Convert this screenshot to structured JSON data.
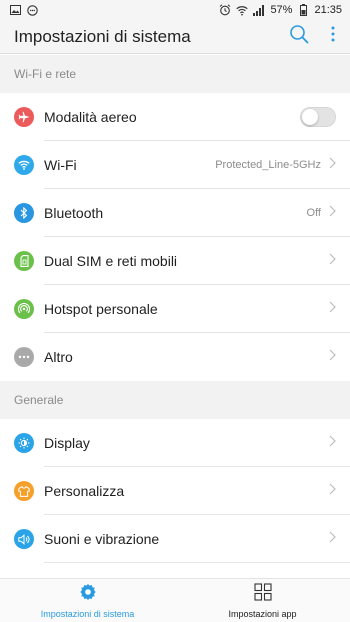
{
  "colors": {
    "accent": "#2a9be0",
    "airplane": "#ec5b5b",
    "wifi": "#2fa9e9",
    "bluetooth": "#2a95e0",
    "dual_sim": "#6bc04b",
    "hotspot": "#6bc04b",
    "altro": "#a9a9a9",
    "display": "#2aa4e6",
    "personalizza": "#f4a02a",
    "suoni": "#2aa4e6"
  },
  "status_bar": {
    "battery": "57%",
    "time": "21:35",
    "icons": [
      "image-icon",
      "chat-icon",
      "alarm-icon",
      "wifi-icon",
      "signal-icon",
      "battery-icon"
    ]
  },
  "header": {
    "title": "Impostazioni di sistema",
    "actions": [
      "search-icon",
      "more-vert-icon"
    ]
  },
  "sections": [
    {
      "title": "Wi-Fi e rete",
      "items": [
        {
          "label": "Modalità aereo",
          "icon": "airplane-icon",
          "toggle": false
        },
        {
          "label": "Wi-Fi",
          "value": "Protected_Line-5GHz",
          "icon": "wifi-icon"
        },
        {
          "label": "Bluetooth",
          "value": "Off",
          "icon": "bluetooth-icon"
        },
        {
          "label": "Dual SIM e reti mobili",
          "icon": "sim-icon"
        },
        {
          "label": "Hotspot personale",
          "icon": "hotspot-icon"
        },
        {
          "label": "Altro",
          "icon": "dots-icon"
        }
      ]
    },
    {
      "title": "Generale",
      "items": [
        {
          "label": "Display",
          "icon": "brightness-icon"
        },
        {
          "label": "Personalizza",
          "icon": "shirt-icon"
        },
        {
          "label": "Suoni e vibrazione",
          "icon": "speaker-icon"
        }
      ]
    }
  ],
  "bottom_nav": [
    {
      "label": "Impostazioni di sistema",
      "icon": "gear-icon",
      "active": true
    },
    {
      "label": "Impostazioni app",
      "icon": "grid-icon",
      "active": false
    }
  ]
}
